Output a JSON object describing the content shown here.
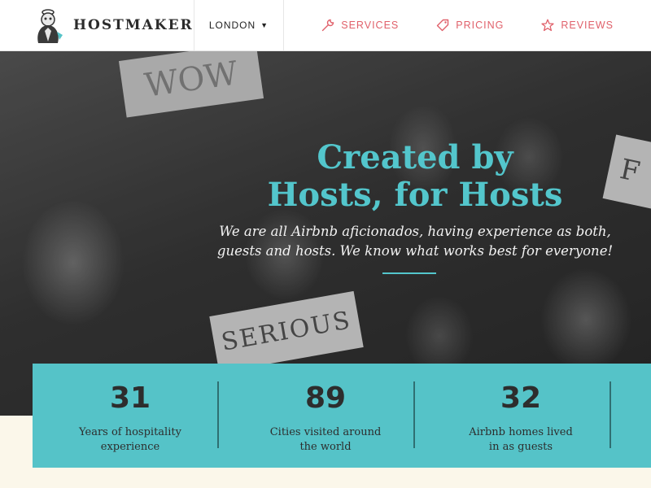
{
  "header": {
    "brand": "HOSTMAKER",
    "city": "LONDON",
    "nav": [
      {
        "label": "SERVICES",
        "icon": "wrench-icon"
      },
      {
        "label": "PRICING",
        "icon": "tag-icon"
      },
      {
        "label": "REVIEWS",
        "icon": "star-icon"
      }
    ]
  },
  "hero": {
    "title_line1": "Created by",
    "title_line2": "Hosts, for Hosts",
    "subtitle_line1": "We are all Airbnb aficionados, having experience as both,",
    "subtitle_line2": "guests and hosts. We know what works best for everyone!",
    "signs": {
      "left": "SERIOUS",
      "top": "WOW",
      "right": "F"
    }
  },
  "stats": [
    {
      "value": "31",
      "label_line1": "Years of hospitality",
      "label_line2": "experience"
    },
    {
      "value": "89",
      "label_line1": "Cities visited around",
      "label_line2": "the world"
    },
    {
      "value": "32",
      "label_line1": "Airbnb homes lived",
      "label_line2": "in as guests"
    }
  ],
  "colors": {
    "accent_teal": "#55c3c8",
    "accent_red": "#e0606a",
    "header_bg": "#ffffff",
    "footer_bg": "#fbf7ea"
  }
}
